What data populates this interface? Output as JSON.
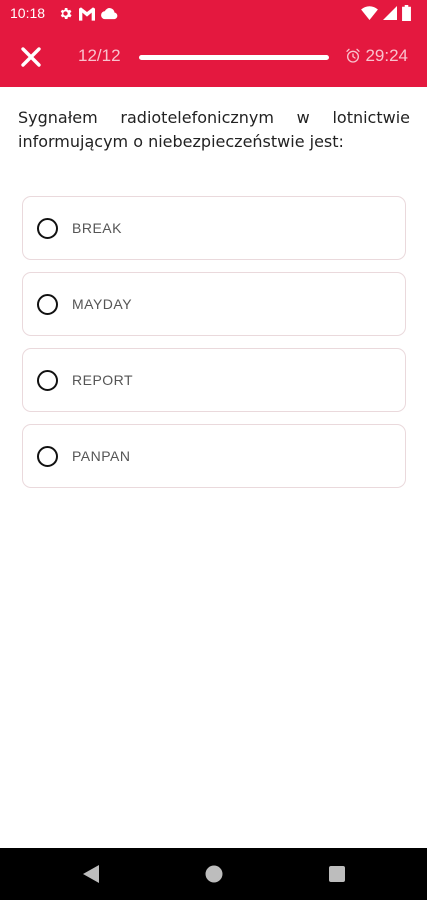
{
  "status_bar": {
    "time": "10:18",
    "icons_left": [
      "settings-icon",
      "gmail-icon",
      "cloud-icon"
    ],
    "icons_right": [
      "wifi-icon",
      "signal-icon",
      "battery-icon"
    ]
  },
  "toolbar": {
    "close_icon": "close-icon",
    "counter": "12/12",
    "progress_fraction": 1.0,
    "timer_icon": "alarm-icon",
    "timer": "29:24"
  },
  "colors": {
    "accent": "#e4183f",
    "text": "#222222",
    "option_text": "#555555",
    "option_border": "#ead9dc"
  },
  "question": {
    "text": "Sygnałem radiotelefonicznym w lotnictwie informującym o niebezpieczeństwie jest:"
  },
  "answers": [
    {
      "label": "BREAK"
    },
    {
      "label": "MAYDAY"
    },
    {
      "label": "REPORT"
    },
    {
      "label": "PANPAN"
    }
  ],
  "nav_bar": {
    "buttons": [
      "back-icon",
      "home-icon",
      "recents-icon"
    ]
  }
}
